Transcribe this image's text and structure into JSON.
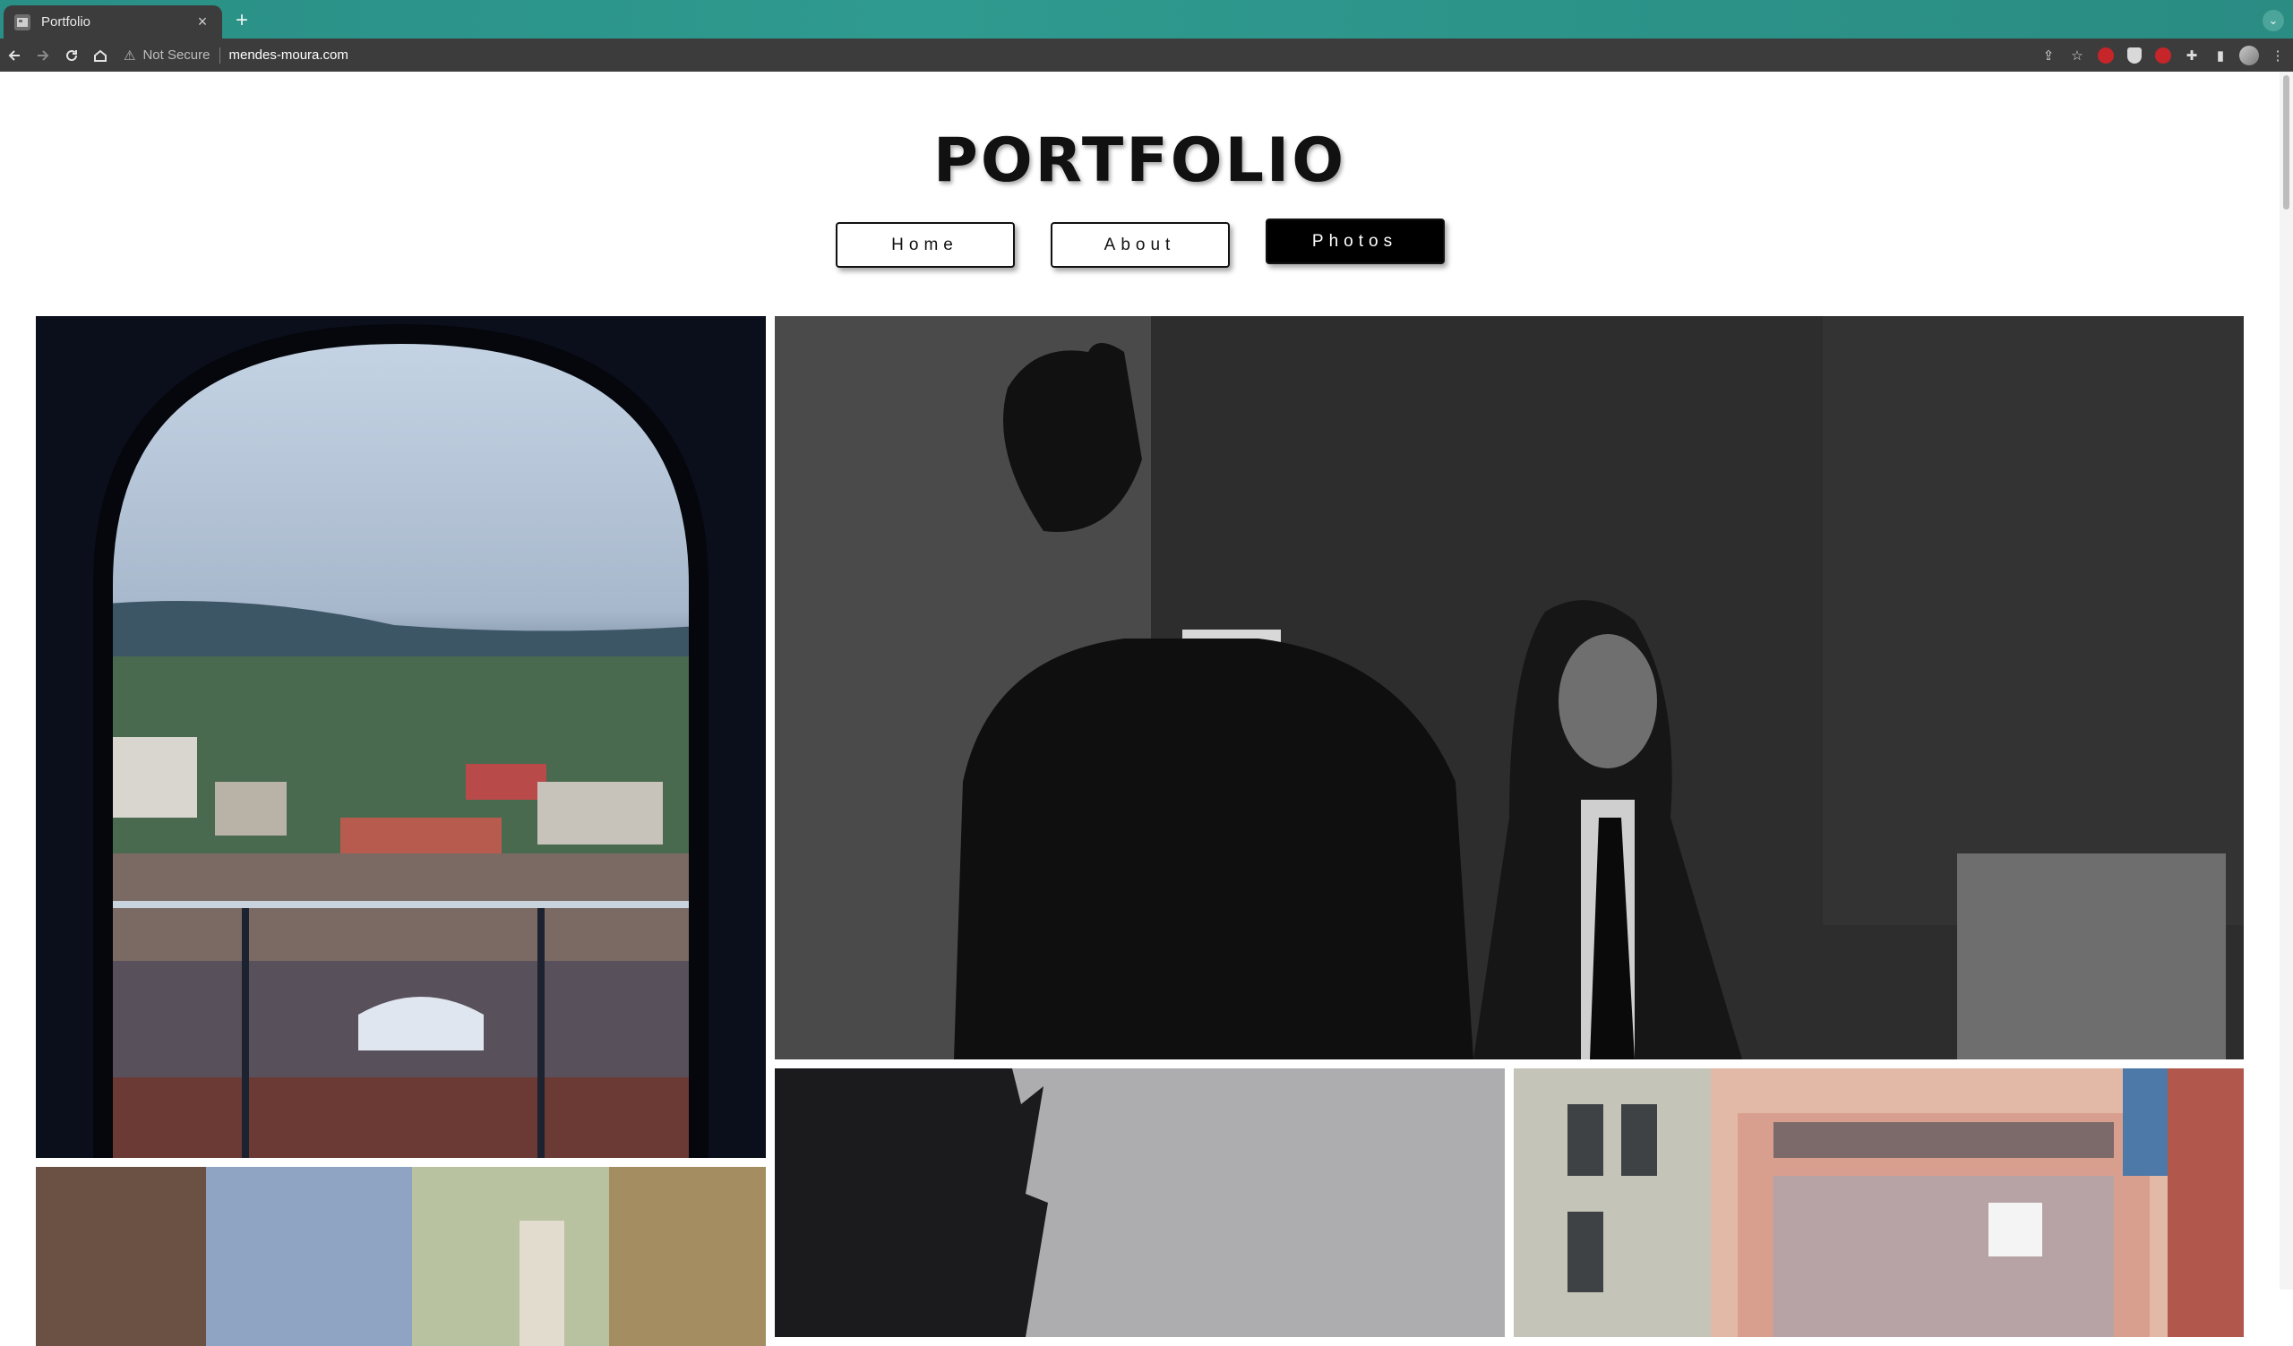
{
  "browser": {
    "tab_title": "Portfolio",
    "tab_close": "×",
    "new_tab": "+",
    "security_label": "Not Secure",
    "url": "mendes-moura.com"
  },
  "site": {
    "title": "PORTFOLIO",
    "nav": [
      {
        "label": "Home",
        "active": false
      },
      {
        "label": "About",
        "active": false
      },
      {
        "label": "Photos",
        "active": true
      }
    ]
  },
  "gallery": {
    "photos": [
      {
        "subject": "city-view-through-window-photo"
      },
      {
        "subject": "two-people-monochrome-photo"
      },
      {
        "subject": "street-buildings-photo"
      },
      {
        "subject": "grey-silhouette-photo"
      },
      {
        "subject": "pink-building-facade-photo"
      }
    ]
  },
  "colors": {
    "tabstrip": "#2f9a8f",
    "toolbar": "#3c3c3c",
    "active_nav_bg": "#000000"
  }
}
